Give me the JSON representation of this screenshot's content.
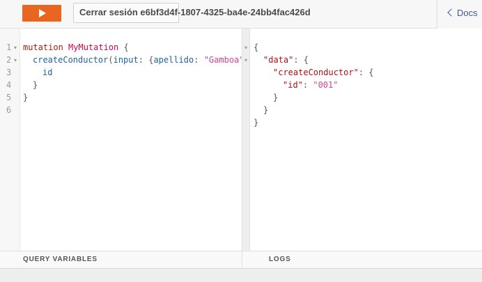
{
  "toolbar": {
    "run_icon": "play-icon",
    "session_label": "Cerrar sesión e6bf3d4f-1807-4325-ba4e-24bb4fac426d",
    "docs_label": "Docs",
    "docs_icon": "chevron-left-icon",
    "accent_color": "#e8661f"
  },
  "editor": {
    "line_numbers": [
      "1",
      "2",
      "3",
      "4",
      "5",
      "6"
    ],
    "line1": {
      "keyword": "mutation",
      "name": "MyMutation",
      "brace": "{"
    },
    "line2": {
      "field": "createConductor",
      "open_paren": "(",
      "arg": "input",
      "colon": ":",
      "obj_open": "{",
      "key": "apellido",
      "key_colon": ":",
      "value": "\"Gamboa\"",
      "comma": ","
    },
    "line3": {
      "field": "id"
    },
    "line4": {
      "brace": "}"
    },
    "line5": {
      "brace": "}"
    }
  },
  "result": {
    "line1": "{",
    "line2": {
      "key": "\"data\"",
      "rest": ": {"
    },
    "line3": {
      "key": "\"createConductor\"",
      "rest": ": {"
    },
    "line4": {
      "key": "\"id\"",
      "colon": ": ",
      "value": "\"001\""
    },
    "line5": "}",
    "line6": "}",
    "line7": "}"
  },
  "bottom": {
    "variables_label": "QUERY VARIABLES",
    "logs_label": "LOGS"
  }
}
